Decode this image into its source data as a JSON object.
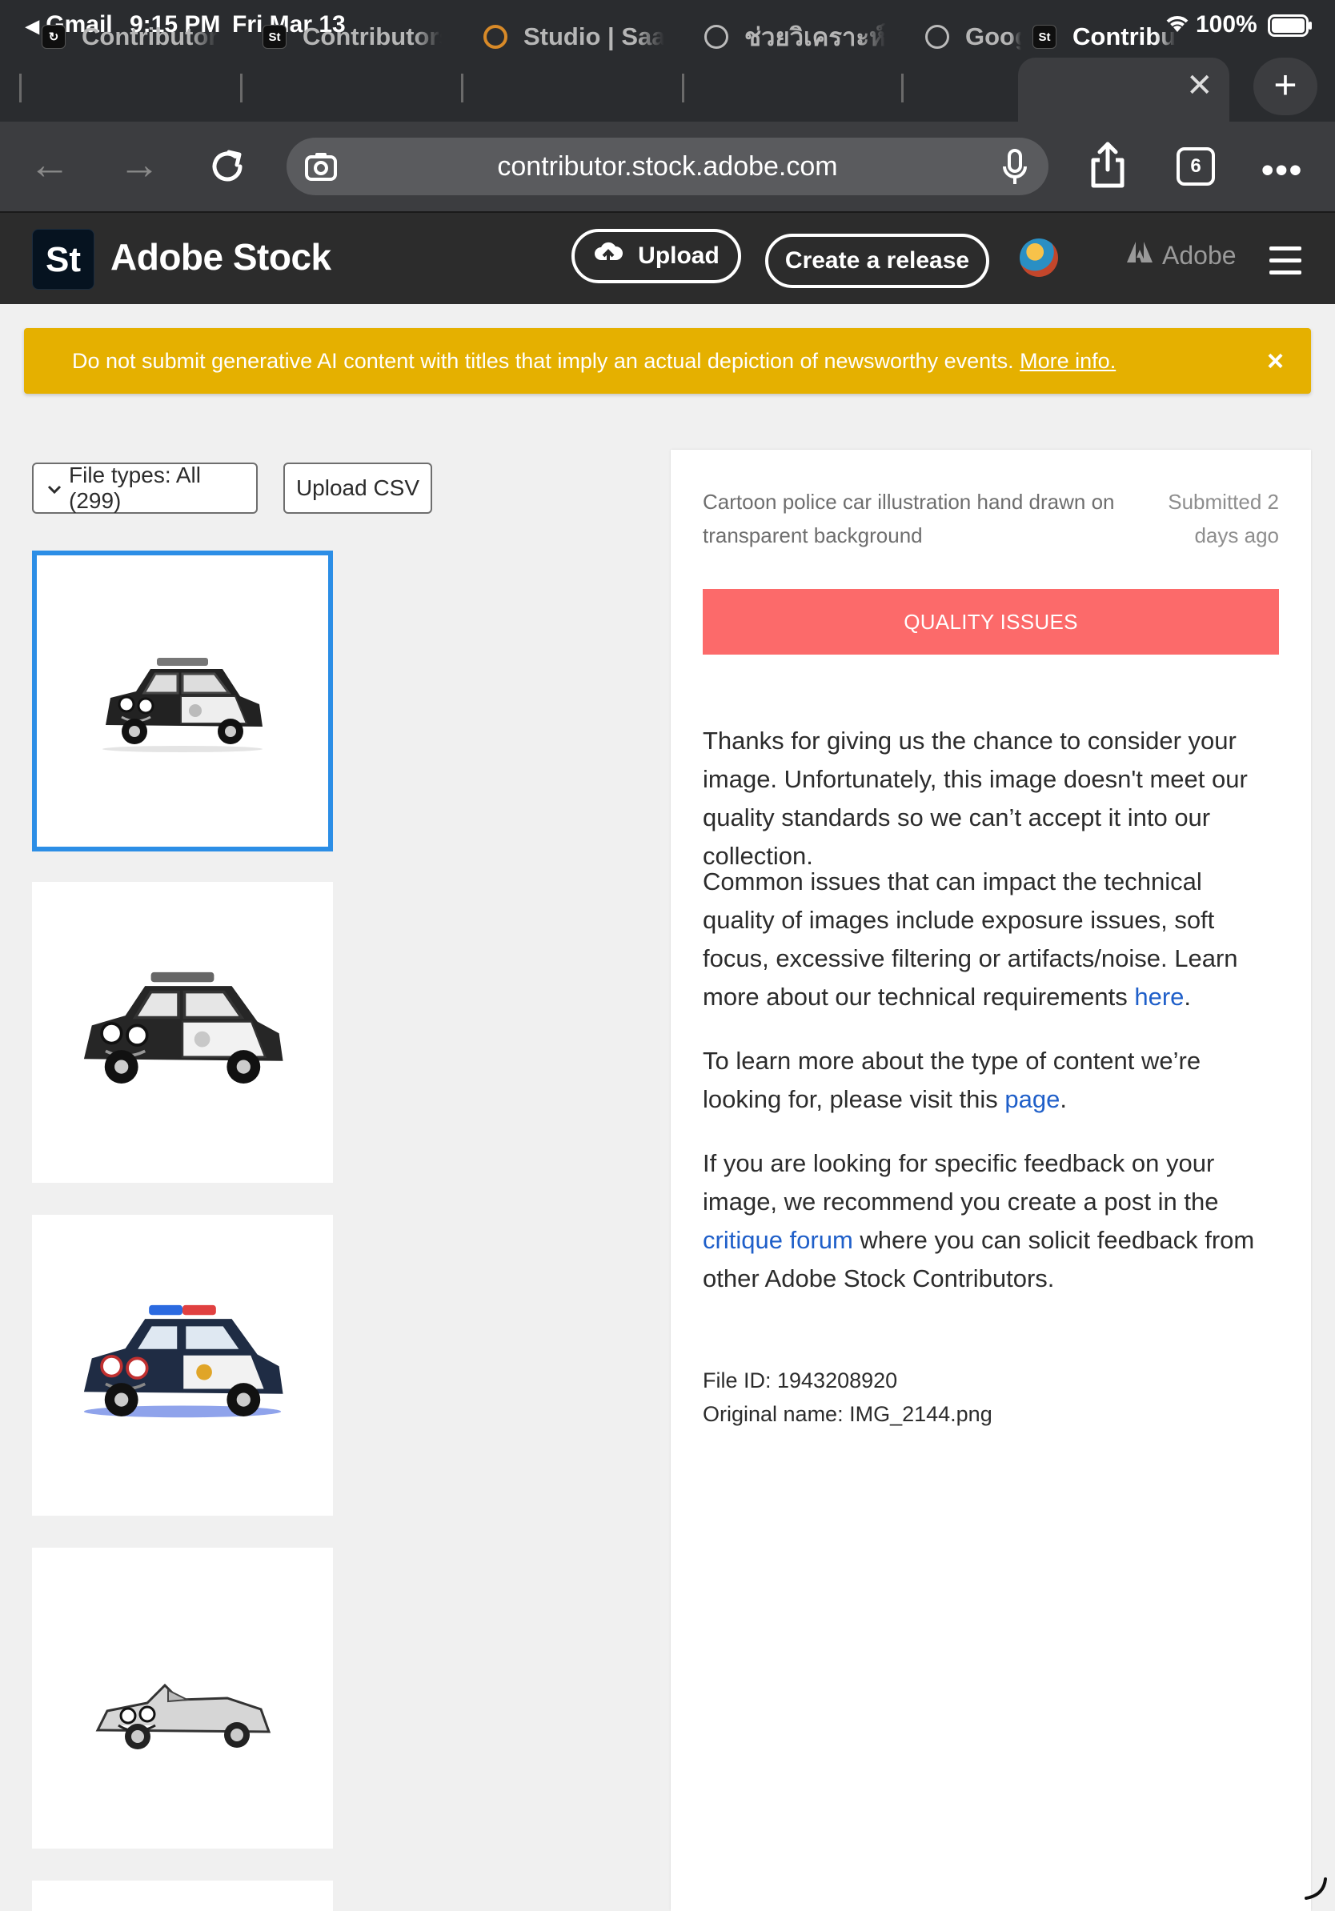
{
  "status_bar": {
    "back_app": "Gmail",
    "time": "9:15 PM",
    "date": "Fri Mar 13",
    "battery": "100%"
  },
  "tabs": [
    {
      "label": "Contributor.",
      "icon": "contributor-favicon"
    },
    {
      "label": "Contributors",
      "icon": "stock-favicon"
    },
    {
      "label": "Studio | Saat",
      "icon": "studio-favicon"
    },
    {
      "label": "ช่วยวิเคราะห์ p",
      "icon": "openai-favicon"
    },
    {
      "label": "Goog",
      "icon": "globe-favicon"
    },
    {
      "label": "Contribu",
      "icon": "stock-favicon",
      "active": true
    }
  ],
  "stock_favicon_text": "St",
  "address_bar": {
    "url": "contributor.stock.adobe.com",
    "tab_count": "6"
  },
  "header": {
    "logo_text": "St",
    "brand": "Adobe Stock",
    "upload_label": "Upload",
    "create_release_label": "Create a release",
    "adobe_label": "Adobe"
  },
  "banner": {
    "text": "Do not submit generative AI content with titles that imply an actual depiction of newsworthy events.",
    "link": "More info.",
    "close": "×",
    "color": "#e5b000"
  },
  "filters": {
    "file_types": "File types: All (299)",
    "upload_csv": "Upload CSV"
  },
  "thumbnails": [
    {
      "alt": "Cartoon police car black and white",
      "selected": true
    },
    {
      "alt": "Cartoon police car black and white large"
    },
    {
      "alt": "Cartoon police car colored blue"
    },
    {
      "alt": "Cartoon convertible car grey"
    }
  ],
  "detail": {
    "title": "Cartoon police car illustration hand drawn on transparent background",
    "submitted": "Submitted 2 days ago",
    "status": "QUALITY ISSUES",
    "status_color": "#fc6a6a",
    "p1": "Thanks for giving us the chance to consider your image. Unfortunately, this image doesn't meet our quality standards so we can’t accept it into our collection.",
    "p2_before": "Common issues that can impact the technical quality of images include exposure issues, soft focus, excessive filtering or artifacts/noise. Learn more about our technical requirements ",
    "p2_link": "here",
    "p2_after": ".",
    "p3_before": "To learn more about the type of content we’re looking for, please visit this ",
    "p3_link": "page",
    "p3_after": ".",
    "p4_before": "If you are looking for specific feedback on your image, we recommend you create a post in the ",
    "p4_link": "critique forum",
    "p4_after": " where you can solicit feedback from other Adobe Stock Contributors.",
    "file_id": "File ID: 1943208920",
    "original_name": "Original name: IMG_2144.png"
  }
}
